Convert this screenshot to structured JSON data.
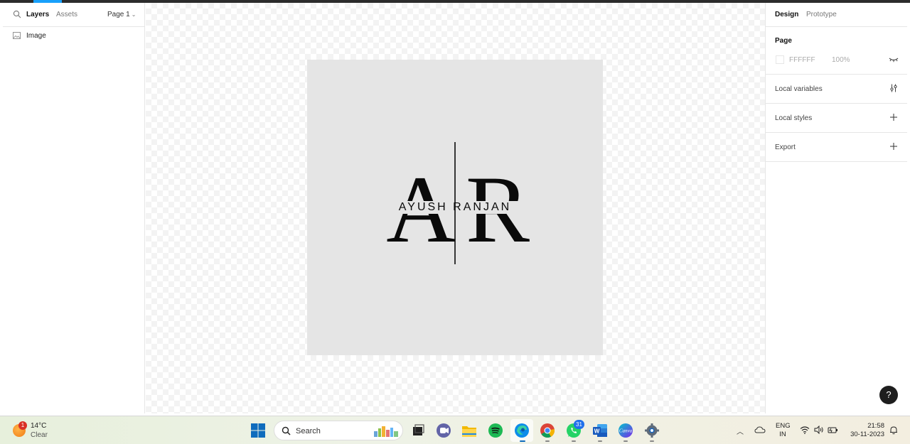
{
  "left_panel": {
    "tabs": {
      "layers": "Layers",
      "assets": "Assets"
    },
    "page_selector": "Page 1",
    "layers": [
      {
        "label": "Image",
        "icon": "image-icon"
      }
    ]
  },
  "canvas": {
    "logo": {
      "text": "AYUSH RANJAN",
      "left_monogram": "A",
      "right_monogram": "R"
    },
    "frame_color": "#e5e5e5"
  },
  "right_panel": {
    "tabs": {
      "design": "Design",
      "prototype": "Prototype"
    },
    "page_section": {
      "title": "Page",
      "color_hex": "FFFFFF",
      "opacity": "100%"
    },
    "sections": [
      {
        "title": "Local variables",
        "action_icon": "sliders-icon"
      },
      {
        "title": "Local styles",
        "action_icon": "plus-icon"
      },
      {
        "title": "Export",
        "action_icon": "plus-icon"
      }
    ]
  },
  "help": {
    "label": "?"
  },
  "taskbar": {
    "weather": {
      "badge": "1",
      "temp": "14°C",
      "condition": "Clear"
    },
    "search_label": "Search",
    "whatsapp_badge": "31",
    "language": {
      "line1": "ENG",
      "line2": "IN"
    },
    "clock": {
      "time": "21:58",
      "date": "30-11-2023"
    }
  }
}
